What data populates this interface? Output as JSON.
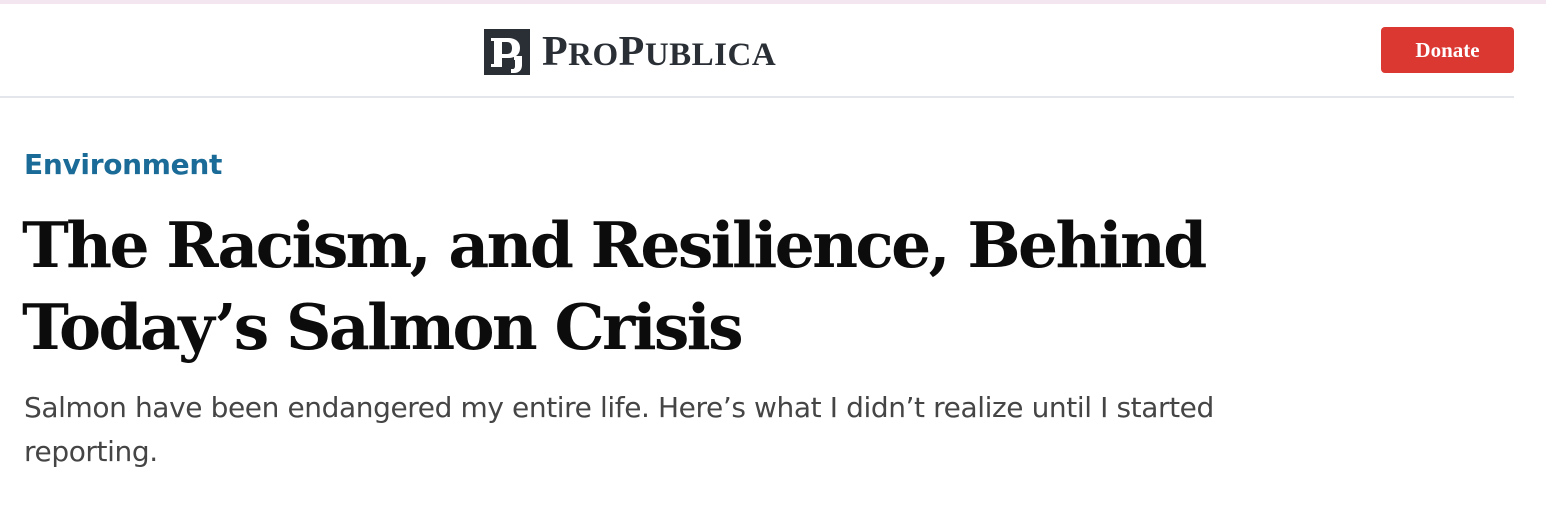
{
  "header": {
    "logo": {
      "name_first_big": "P",
      "name_first_small": "RO",
      "name_second_big": "P",
      "name_second_small": "UBLICA",
      "icon": "propublica-pj-icon",
      "color": "#2a2f36"
    },
    "donate_label": "Donate",
    "donate_color": "#db3832"
  },
  "article": {
    "category": "Environment",
    "category_color": "#1a6b97",
    "headline": "The Racism, and Resilience, Behind Today’s Salmon Crisis",
    "dek": "Salmon have been endangered my entire life. Here’s what I didn’t realize until I started reporting."
  }
}
